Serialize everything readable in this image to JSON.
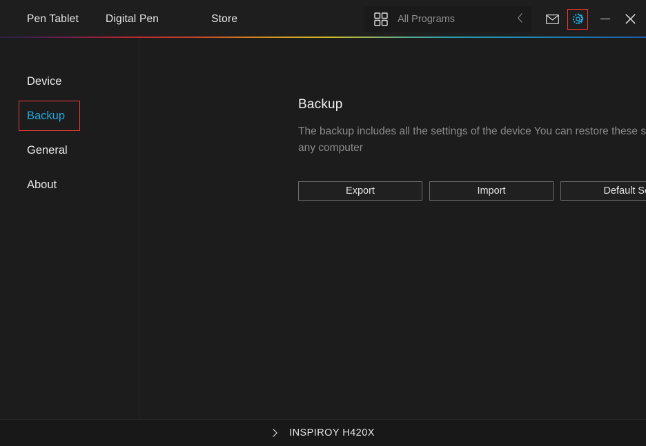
{
  "window": {
    "accent_teal": "#22a7dd",
    "highlight_red": "#ef3b36",
    "background": "#1c1c1c"
  },
  "header": {
    "nav": [
      {
        "label": "Pen Tablet"
      },
      {
        "label": "Digital Pen"
      },
      {
        "label": "Store"
      }
    ],
    "programs": {
      "label": "All Programs",
      "grid_icon": "grid-icon",
      "chevron_icon": "chevron-left-icon"
    },
    "mail_icon": "mail-icon",
    "settings_icon": "gear-icon",
    "minimize_icon": "minimize-icon",
    "close_icon": "close-icon"
  },
  "sidebar": {
    "items": [
      {
        "label": "Device",
        "active": false
      },
      {
        "label": "Backup",
        "active": true
      },
      {
        "label": "General",
        "active": false
      },
      {
        "label": "About",
        "active": false
      }
    ]
  },
  "main": {
    "title": "Backup",
    "description": "The backup includes all the settings of the device You can restore these settings  on any computer",
    "buttons": [
      {
        "label": "Export"
      },
      {
        "label": "Import"
      },
      {
        "label": "Default Setting"
      }
    ]
  },
  "footer": {
    "chevron_icon": "chevron-right-icon",
    "device": "INSPIROY H420X"
  }
}
